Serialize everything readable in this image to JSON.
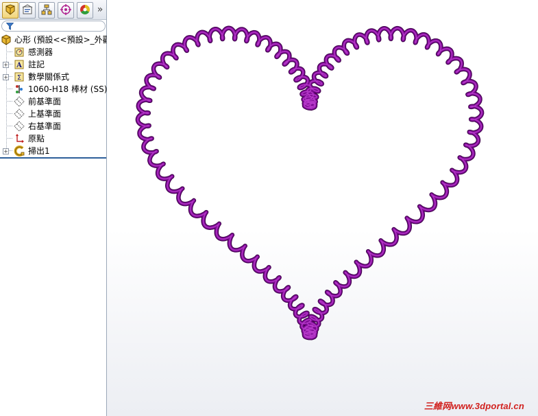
{
  "tabs": [
    {
      "name": "feature-manager",
      "icon": "feature-tree-icon",
      "active": true
    },
    {
      "name": "property-manager",
      "icon": "property-manager-icon",
      "active": false
    },
    {
      "name": "configuration-manager",
      "icon": "configuration-manager-icon",
      "active": false
    },
    {
      "name": "dimxpert-manager",
      "icon": "crosshair-icon",
      "active": false
    },
    {
      "name": "display-manager",
      "icon": "color-wheel-icon",
      "active": false
    }
  ],
  "tab_more_label": "»",
  "tree": {
    "root": "心形 (預設<<預設>_外觀",
    "items": [
      {
        "label": "感測器",
        "icon": "sensor-icon",
        "expandable": false
      },
      {
        "label": "註記",
        "icon": "annotation-icon",
        "expandable": true
      },
      {
        "label": "數學關係式",
        "icon": "equation-icon",
        "expandable": true
      },
      {
        "label": "1060-H18 棒材 (SS)",
        "icon": "material-icon",
        "expandable": false
      },
      {
        "label": "前基準面",
        "icon": "plane-icon",
        "expandable": false
      },
      {
        "label": "上基準面",
        "icon": "plane-icon",
        "expandable": false
      },
      {
        "label": "右基準面",
        "icon": "plane-icon",
        "expandable": false
      },
      {
        "label": "原點",
        "icon": "origin-icon",
        "expandable": false
      },
      {
        "label": "掃出1",
        "icon": "sweep-icon",
        "expandable": true
      }
    ]
  },
  "model": {
    "shape": "heart coil spring",
    "color": "#7d0c93",
    "highlight_color": "#b638c9",
    "shadow_color": "#3d0349"
  },
  "watermark": "三維网www.3dportal.cn"
}
